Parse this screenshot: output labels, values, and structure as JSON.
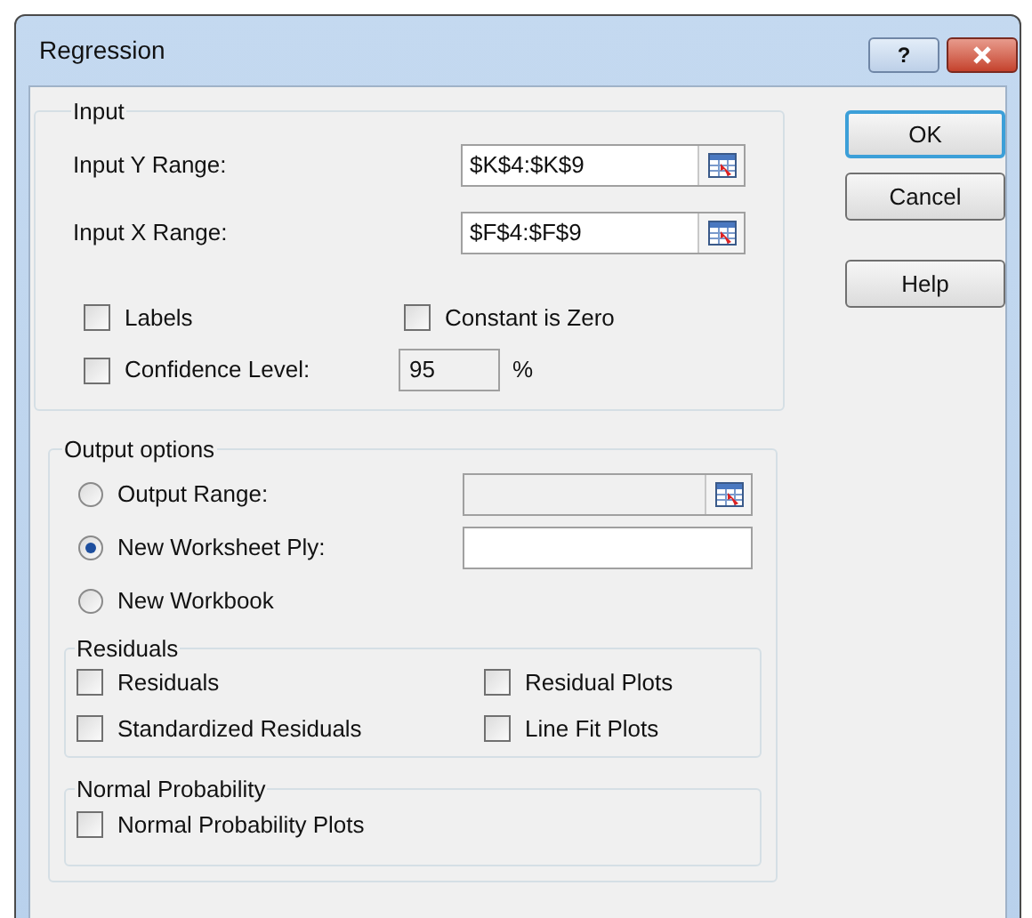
{
  "window": {
    "title": "Regression",
    "help_label": "?"
  },
  "input": {
    "title": "Input",
    "ranges": [
      {
        "label": "Input Y Range:",
        "value": "$K$4:$K$9"
      },
      {
        "label": "Input X Range:",
        "value": "$F$4:$F$9"
      }
    ],
    "options": [
      {
        "label": "Labels",
        "checked": false
      },
      {
        "label": "Constant is Zero",
        "checked": false
      },
      {
        "label": "Confidence Level:",
        "checked": false
      }
    ],
    "confidence": {
      "value": "95",
      "unit": "%",
      "disabled": true
    }
  },
  "output": {
    "title": "Output options",
    "destinations": [
      {
        "label": "Output Range:",
        "selected": false,
        "field": {
          "disabled": true,
          "kind": "range"
        }
      },
      {
        "label": "New Worksheet Ply:",
        "selected": true,
        "field": {
          "disabled": false,
          "kind": "text"
        }
      },
      {
        "label": "New Workbook",
        "selected": false
      }
    ],
    "residuals": {
      "title": "Residuals",
      "options": [
        {
          "label": "Residuals",
          "checked": false
        },
        {
          "label": "Residual Plots",
          "checked": false
        },
        {
          "label": "Standardized Residuals",
          "checked": false
        },
        {
          "label": "Line Fit Plots",
          "checked": false
        }
      ]
    },
    "normal_probability": {
      "title": "Normal Probability",
      "options": [
        {
          "label": "Normal Probability Plots",
          "checked": false
        }
      ]
    }
  },
  "buttons": [
    {
      "label": "OK",
      "default": true
    },
    {
      "label": "Cancel",
      "default": false
    },
    {
      "label": "Help",
      "default": false
    }
  ]
}
